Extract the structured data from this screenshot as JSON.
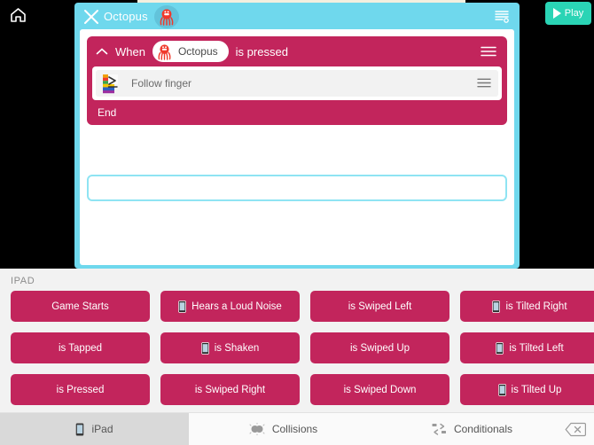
{
  "colors": {
    "pink": "#c2255c",
    "cyan": "#6fd8ed",
    "green": "#2ad4b5",
    "drawer_bg": "#f2f2f2",
    "drop_border": "#8fe4f3"
  },
  "toolbar": {
    "home_icon": "home-icon",
    "play_label": "Play",
    "play_icon": "play-triangle-icon"
  },
  "editor": {
    "close_icon": "close-x-icon",
    "title": "Octopus",
    "avatar_icon": "octopus-avatar-icon",
    "list_icon": "list-options-icon"
  },
  "script": {
    "when": {
      "collapse_icon": "chevron-up-icon",
      "keyword": "When",
      "actor": "Octopus",
      "actor_icon": "octopus-icon",
      "suffix": "is pressed",
      "menu_icon": "hamburger-menu-icon"
    },
    "actions": [
      {
        "label": "Follow finger",
        "icon": "rainbow-cursor-icon",
        "menu_icon": "hamburger-menu-icon"
      }
    ],
    "end_label": "End",
    "drop_zone_placeholder": ""
  },
  "drawer": {
    "section_label": "IPAD",
    "buttons": [
      {
        "label": "Game Starts",
        "icon": null
      },
      {
        "label": "Hears a Loud Noise",
        "icon": "device-icon"
      },
      {
        "label": "is Swiped Left",
        "icon": null
      },
      {
        "label": "is Tilted Right",
        "icon": "device-icon"
      },
      {
        "label": "is Tapped",
        "icon": null
      },
      {
        "label": "is Shaken",
        "icon": "device-icon"
      },
      {
        "label": "is Swiped Up",
        "icon": null
      },
      {
        "label": "is Tilted Left",
        "icon": "device-icon"
      },
      {
        "label": "is Pressed",
        "icon": null
      },
      {
        "label": "is Swiped Right",
        "icon": null
      },
      {
        "label": "is Swiped Down",
        "icon": null
      },
      {
        "label": "is Tilted Up",
        "icon": "device-icon"
      }
    ]
  },
  "tabs": [
    {
      "label": "iPad",
      "icon": "device-icon",
      "active": true
    },
    {
      "label": "Collisions",
      "icon": "collision-icon",
      "active": false
    },
    {
      "label": "Conditionals",
      "icon": "conditional-icon",
      "active": false
    }
  ],
  "delete_key_icon": "backspace-delete-icon"
}
